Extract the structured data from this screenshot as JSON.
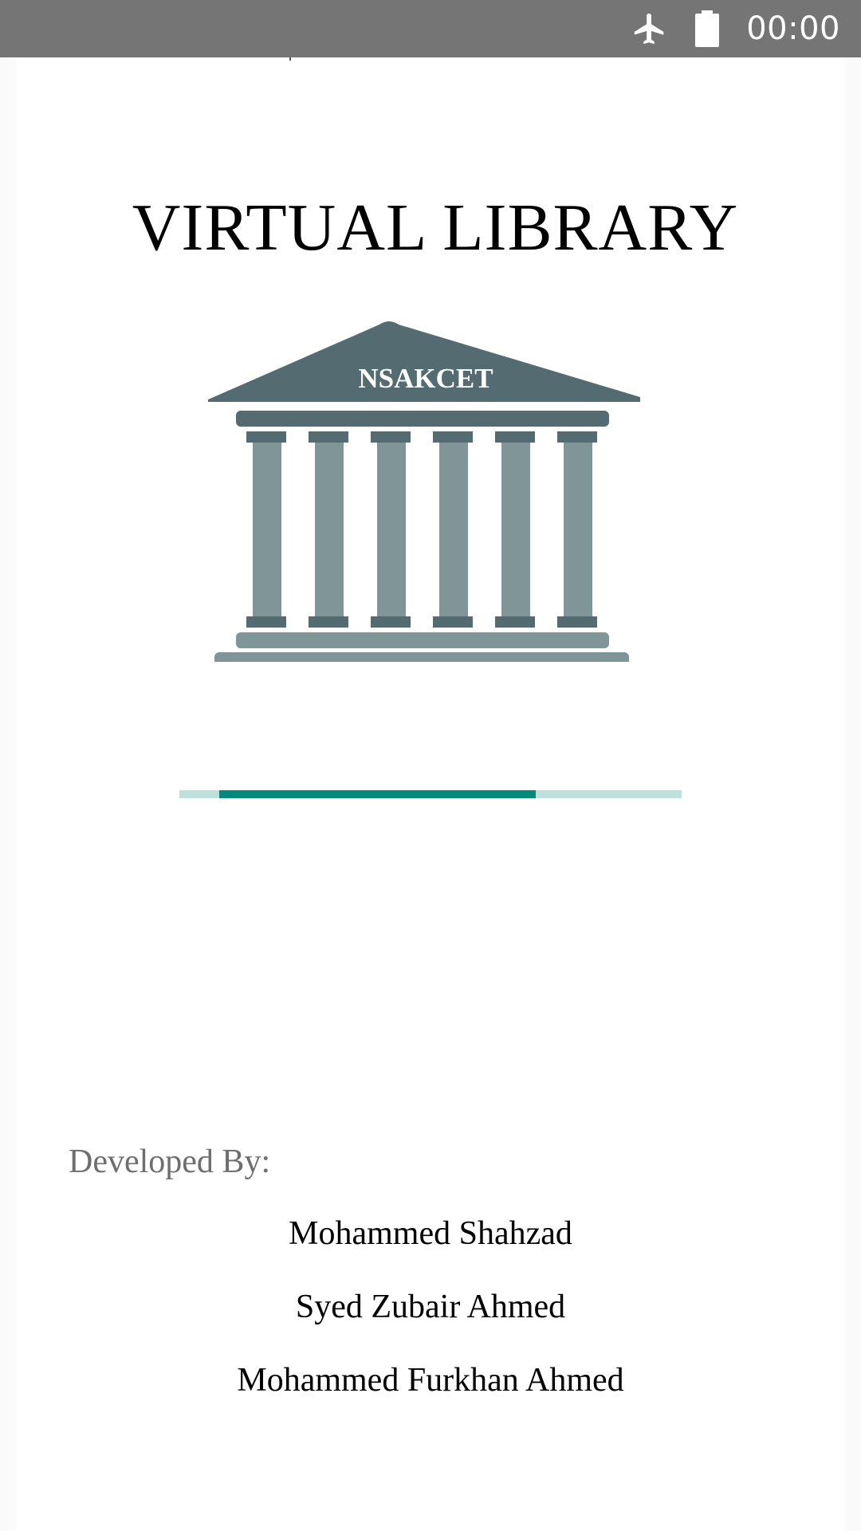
{
  "status_bar": {
    "time": "00:00",
    "icons": [
      "airplane-mode-icon",
      "battery-full-icon"
    ],
    "background": "#757575"
  },
  "app": {
    "title": "VIRTUAL LIBRARY",
    "logo": {
      "text": "NSAKCET",
      "icon": "library-building-icon",
      "colors": {
        "roof": "#546c71",
        "column": "#7f9597"
      }
    },
    "progress": {
      "type": "indeterminate",
      "fill_start": 0.08,
      "fill_end": 0.71,
      "colors": {
        "track": "#bde0dc",
        "fill": "#00897b"
      }
    },
    "credits": {
      "heading": "Developed By:",
      "names": [
        "Mohammed Shahzad",
        "Syed Zubair Ahmed",
        "Mohammed Furkhan Ahmed"
      ]
    }
  }
}
